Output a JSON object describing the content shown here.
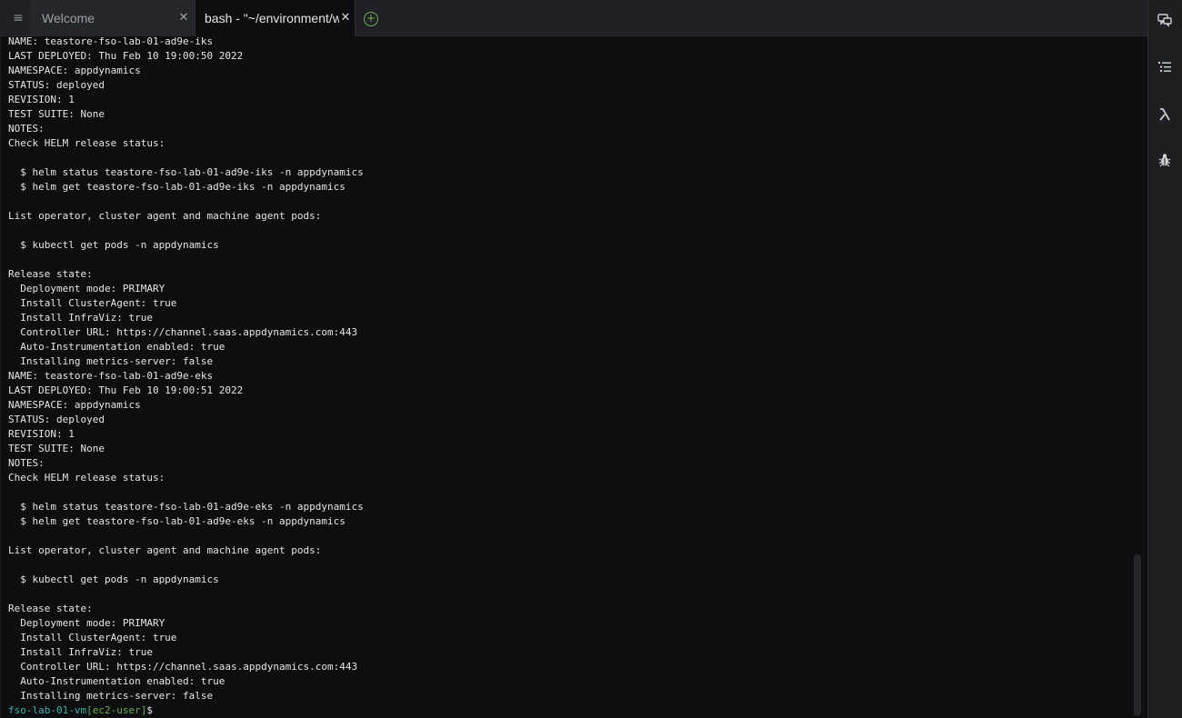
{
  "tabs": [
    {
      "label": "Welcome",
      "active": false
    },
    {
      "label": "bash - \"~/environment/wo",
      "active": true
    }
  ],
  "icons": {
    "menu": "hamburger-icon",
    "close": "close-icon",
    "add_tab": "plus-circle-icon",
    "sidebar": [
      "chat-icon",
      "outline-list-icon",
      "lambda-icon",
      "bug-icon"
    ]
  },
  "colors": {
    "terminal_bg": "#0d0e10",
    "terminal_text": "#e6e6e6",
    "prompt_host": "#3fb0a8",
    "prompt_user": "#6fae54",
    "accent_add": "#6fae54"
  },
  "terminal": {
    "lines": [
      "NAME: teastore-fso-lab-01-ad9e-iks",
      "LAST DEPLOYED: Thu Feb 10 19:00:50 2022",
      "NAMESPACE: appdynamics",
      "STATUS: deployed",
      "REVISION: 1",
      "TEST SUITE: None",
      "NOTES:",
      "Check HELM release status:",
      "",
      "  $ helm status teastore-fso-lab-01-ad9e-iks -n appdynamics",
      "  $ helm get teastore-fso-lab-01-ad9e-iks -n appdynamics",
      "",
      "List operator, cluster agent and machine agent pods:",
      "",
      "  $ kubectl get pods -n appdynamics",
      "",
      "Release state:",
      "  Deployment mode: PRIMARY",
      "  Install ClusterAgent: true",
      "  Install InfraViz: true",
      "  Controller URL: https://channel.saas.appdynamics.com:443",
      "  Auto-Instrumentation enabled: true",
      "  Installing metrics-server: false",
      "NAME: teastore-fso-lab-01-ad9e-eks",
      "LAST DEPLOYED: Thu Feb 10 19:00:51 2022",
      "NAMESPACE: appdynamics",
      "STATUS: deployed",
      "REVISION: 1",
      "TEST SUITE: None",
      "NOTES:",
      "Check HELM release status:",
      "",
      "  $ helm status teastore-fso-lab-01-ad9e-eks -n appdynamics",
      "  $ helm get teastore-fso-lab-01-ad9e-eks -n appdynamics",
      "",
      "List operator, cluster agent and machine agent pods:",
      "",
      "  $ kubectl get pods -n appdynamics",
      "",
      "Release state:",
      "  Deployment mode: PRIMARY",
      "  Install ClusterAgent: true",
      "  Install InfraViz: true",
      "  Controller URL: https://channel.saas.appdynamics.com:443",
      "  Auto-Instrumentation enabled: true",
      "  Installing metrics-server: false"
    ],
    "prompt": {
      "host": "fso-lab-01-vm",
      "user": "[ec2-user]",
      "symbol": "$"
    }
  }
}
